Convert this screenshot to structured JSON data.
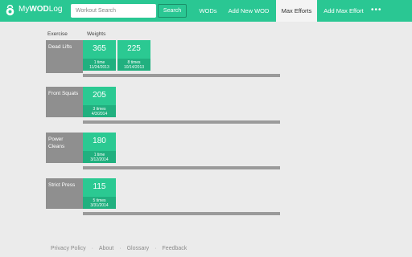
{
  "header": {
    "logo": {
      "prefix": "My",
      "bold": "WOD",
      "suffix": "Log"
    },
    "search": {
      "placeholder": "Workout Search",
      "button": "Search"
    },
    "nav": [
      {
        "label": "WODs"
      },
      {
        "label": "Add New WOD"
      },
      {
        "label": "Max Efforts"
      },
      {
        "label": "Add Max Effort"
      }
    ],
    "more": "•••"
  },
  "columns": {
    "exercise": "Exercise",
    "weights": "Weights"
  },
  "exercises": [
    {
      "name": "Dead Lifts",
      "entries": [
        {
          "weight": "365",
          "count": "1 time",
          "date": "11/24/2013"
        },
        {
          "weight": "225",
          "count": "8 times",
          "date": "10/14/2013"
        }
      ]
    },
    {
      "name": "Front Squats",
      "entries": [
        {
          "weight": "205",
          "count": "3 times",
          "date": "4/3/2014"
        }
      ]
    },
    {
      "name": "Power Cleans",
      "entries": [
        {
          "weight": "180",
          "count": "1 time",
          "date": "3/12/2014"
        }
      ]
    },
    {
      "name": "Strict Press",
      "entries": [
        {
          "weight": "115",
          "count": "5 times",
          "date": "3/31/2014"
        }
      ]
    }
  ],
  "footer": {
    "links": [
      "Privacy Policy",
      "About",
      "Glossary",
      "Feedback"
    ],
    "separator": "·"
  }
}
